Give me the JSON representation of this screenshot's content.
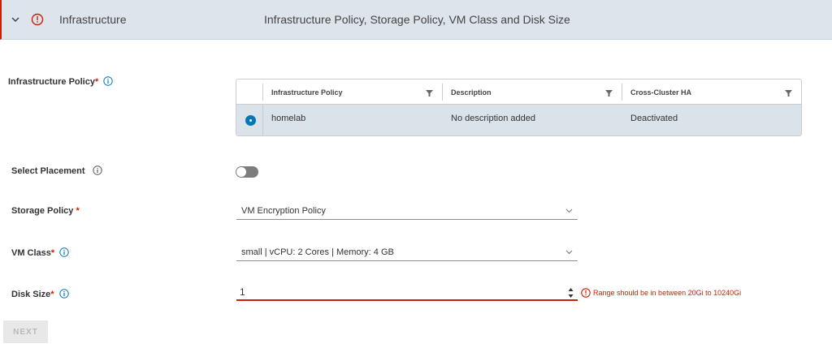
{
  "header": {
    "title": "Infrastructure",
    "subtitle": "Infrastructure Policy, Storage Policy, VM Class and Disk Size",
    "status_color": "#c92100"
  },
  "infrastructure_policy": {
    "label": "Infrastructure Policy",
    "required_mark": "*",
    "columns": [
      "Infrastructure Policy",
      "Description",
      "Cross-Cluster HA"
    ],
    "rows": [
      {
        "selected": true,
        "cells": [
          "homelab",
          "No description added",
          "Deactivated"
        ]
      }
    ]
  },
  "select_placement": {
    "label": "Select Placement",
    "enabled": false
  },
  "storage_policy": {
    "label": "Storage Policy",
    "required_mark": "*",
    "value": "VM Encryption Policy"
  },
  "vm_class": {
    "label": "VM Class",
    "required_mark": "*",
    "value": "small | vCPU: 2 Cores | Memory: 4 GB"
  },
  "disk_size": {
    "label": "Disk Size",
    "required_mark": "*",
    "value": "1",
    "error": "Range should be in between 20Gi to 10240Gi"
  },
  "buttons": {
    "next": "NEXT"
  },
  "colors": {
    "accent": "#0079b8",
    "error": "#c92100",
    "header_bg": "#dde4eb"
  }
}
